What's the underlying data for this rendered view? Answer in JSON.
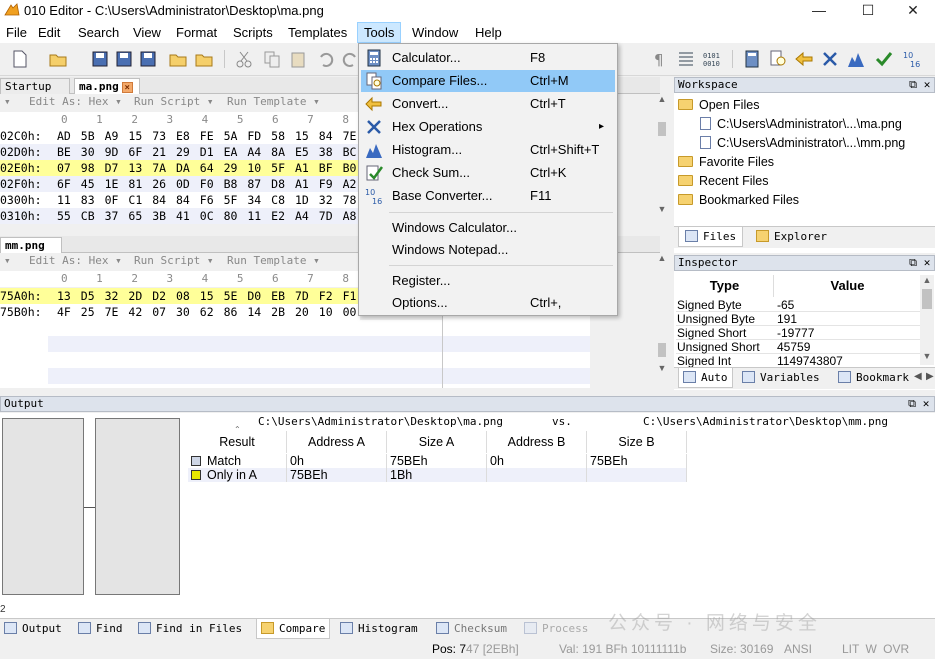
{
  "window": {
    "title": "010 Editor - C:\\Users\\Administrator\\Desktop\\ma.png",
    "minimize": "—",
    "maximize": "☐",
    "close": "✕"
  },
  "menubar": [
    "File",
    "Edit",
    "Search",
    "View",
    "Format",
    "Scripts",
    "Templates",
    "Tools",
    "Window",
    "Help"
  ],
  "tools_menu": {
    "items": [
      {
        "label": "Calculator...",
        "shortcut": "F8",
        "icon": "calculator-icon"
      },
      {
        "label": "Compare Files...",
        "shortcut": "Ctrl+M",
        "icon": "compare-files-icon",
        "highlighted": true
      },
      {
        "label": "Convert...",
        "shortcut": "Ctrl+T",
        "icon": "convert-icon"
      },
      {
        "label": "Hex Operations",
        "shortcut": "",
        "icon": "hex-operations-icon",
        "submenu": true
      },
      {
        "label": "Histogram...",
        "shortcut": "Ctrl+Shift+T",
        "icon": "histogram-icon"
      },
      {
        "label": "Check Sum...",
        "shortcut": "Ctrl+K",
        "icon": "checksum-icon"
      },
      {
        "label": "Base Converter...",
        "shortcut": "F11",
        "icon": "base-converter-icon"
      },
      {
        "label": "Windows Calculator...",
        "shortcut": ""
      },
      {
        "label": "Windows Notepad...",
        "shortcut": ""
      },
      {
        "label": "Register...",
        "shortcut": ""
      },
      {
        "label": "Options...",
        "shortcut": "Ctrl+,"
      }
    ],
    "submenu_arrow": "▸"
  },
  "editor_top": {
    "tabs": [
      {
        "label": "Startup",
        "close": "×"
      },
      {
        "label": "ma.png",
        "close": "×"
      }
    ],
    "edit_as": "Edit As: Hex",
    "run_script": "Run Script",
    "run_template": "Run Template",
    "col_header": "0  1  2  3  4  5  6  7  8  9  A  B  C",
    "rows": [
      {
        "addr": "02C0h:",
        "bytes": [
          "AD",
          "5B",
          "A9",
          "15",
          "73",
          "E8",
          "FE",
          "5A",
          "FD",
          "58",
          "15",
          "84",
          "7E"
        ],
        "style": "normal"
      },
      {
        "addr": "02D0h:",
        "bytes": [
          "BE",
          "30",
          "9D",
          "6F",
          "21",
          "29",
          "D1",
          "EA",
          "A4",
          "8A",
          "E5",
          "38",
          "BC"
        ],
        "style": "alt"
      },
      {
        "addr": "02E0h:",
        "bytes": [
          "07",
          "98",
          "D7",
          "13",
          "7A",
          "DA",
          "64",
          "29",
          "10",
          "5F",
          "A1",
          "BF",
          "B0"
        ],
        "style": "hl"
      },
      {
        "addr": "02F0h:",
        "bytes": [
          "6F",
          "45",
          "1E",
          "81",
          "26",
          "0D",
          "F0",
          "B8",
          "87",
          "D8",
          "A1",
          "F9",
          "A2"
        ],
        "style": "alt"
      },
      {
        "addr": "0300h:",
        "bytes": [
          "11",
          "83",
          "0F",
          "C1",
          "84",
          "84",
          "F6",
          "5F",
          "34",
          "C8",
          "1D",
          "32",
          "78"
        ],
        "style": "normal"
      },
      {
        "addr": "0310h:",
        "bytes": [
          "55",
          "CB",
          "37",
          "65",
          "3B",
          "41",
          "0C",
          "80",
          "11",
          "E2",
          "A4",
          "7D",
          "A8"
        ],
        "style": "alt"
      }
    ]
  },
  "editor_bottom": {
    "tabs": [
      {
        "label": "mm.png",
        "close": "×"
      }
    ],
    "edit_as": "Edit As: Hex",
    "run_script": "Run Script",
    "run_template": "Run Template",
    "col_header": "0  1  2  3  4  5  6  7  8  9  A  B  C",
    "rows": [
      {
        "addr": "75A0h:",
        "bytes": [
          "13",
          "D5",
          "32",
          "2D",
          "D2",
          "08",
          "15",
          "5E",
          "D0",
          "EB",
          "7D",
          "F2",
          "F1"
        ],
        "style": "hl"
      },
      {
        "addr": "75B0h:",
        "bytes": [
          "4F",
          "25",
          "7E",
          "42",
          "07",
          "30",
          "62",
          "86",
          "14",
          "2B",
          "20",
          "10",
          "00"
        ],
        "style": "normal"
      }
    ]
  },
  "workspace": {
    "title": "Workspace",
    "open_files": "Open Files",
    "files": [
      "C:\\Users\\Administrator\\...\\ma.png",
      "C:\\Users\\Administrator\\...\\mm.png"
    ],
    "favorite": "Favorite Files",
    "recent": "Recent Files",
    "bookmarked": "Bookmarked Files",
    "tabs": [
      "Files",
      "Explorer"
    ]
  },
  "inspector": {
    "title": "Inspector",
    "col_type": "Type",
    "col_value": "Value",
    "rows": [
      {
        "type": "Signed Byte",
        "value": "-65"
      },
      {
        "type": "Unsigned Byte",
        "value": "191"
      },
      {
        "type": "Signed Short",
        "value": "-19777"
      },
      {
        "type": "Unsigned Short",
        "value": "45759"
      },
      {
        "type": "Signed Int",
        "value": "1149743807"
      }
    ],
    "tabs": [
      "Auto",
      "Variables",
      "Bookmark"
    ]
  },
  "output": {
    "title": "Output",
    "file_a": "C:\\Users\\Administrator\\Desktop\\ma.png",
    "vs": "vs.",
    "file_b": "C:\\Users\\Administrator\\Desktop\\mm.png",
    "headers": [
      "Result",
      "Address A",
      "Size A",
      "Address B",
      "Size B"
    ],
    "rows": [
      {
        "result": "Match",
        "addr_a": "0h",
        "size_a": "75BEh",
        "addr_b": "0h",
        "size_b": "75BEh",
        "color": "#ced6e6"
      },
      {
        "result": "Only in A",
        "addr_a": "75BEh",
        "size_a": "1Bh",
        "addr_b": "",
        "size_b": "",
        "color": "#e8e800"
      }
    ],
    "tabs": [
      "Output",
      "Find",
      "Find in Files",
      "Compare",
      "Histogram",
      "Checksum",
      "Process"
    ]
  },
  "status": {
    "pos": "Pos: 7",
    "pos_rest": "47 [2EBh]",
    "val": "Val: 191 BFh 10111111b",
    "size": "Size: 30169",
    "enc": "ANSI",
    "flags": "LIT  W  OVR"
  },
  "watermark": "公众号 · 网络与安全"
}
